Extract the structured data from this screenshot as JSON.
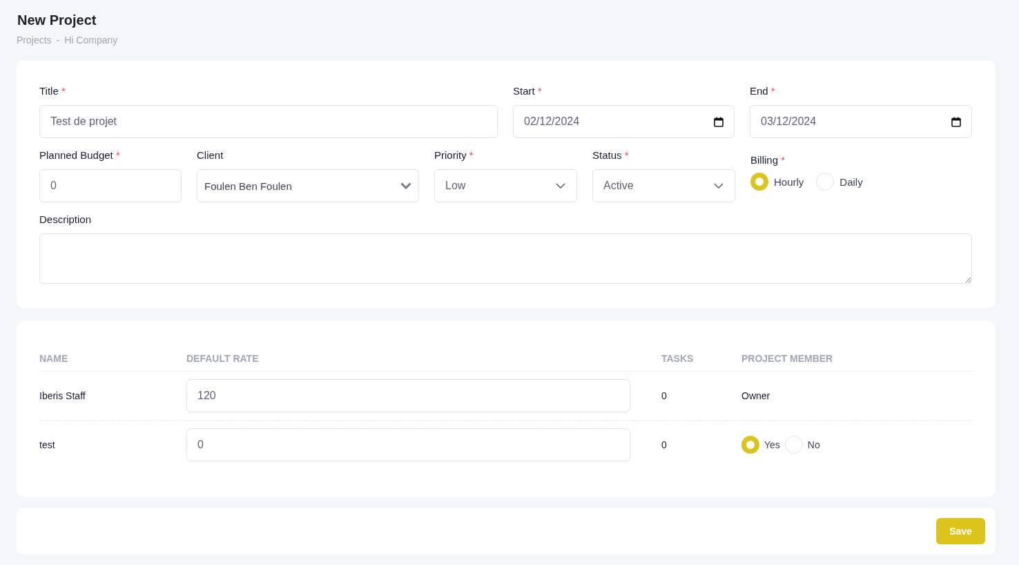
{
  "header": {
    "title": "New Project",
    "breadcrumb": [
      "Projects",
      "Hi Company"
    ],
    "separator": "-"
  },
  "required_mark": "*",
  "form": {
    "rows": [
      {
        "fields": [
          {
            "kind": "text",
            "label": "Title",
            "required": true,
            "value": "Test de projet"
          },
          {
            "kind": "date",
            "label": "Start",
            "required": true,
            "value": "02/12/2024"
          },
          {
            "kind": "date",
            "label": "End",
            "required": true,
            "value": "03/12/2024"
          }
        ]
      },
      {
        "fields": [
          {
            "kind": "number",
            "label": "Planned Budget",
            "required": true,
            "value": "0"
          },
          {
            "kind": "select",
            "label": "Client",
            "required": false,
            "value": "Foulen Ben Foulen"
          },
          {
            "kind": "select",
            "label": "Priority",
            "required": true,
            "value": "Low"
          },
          {
            "kind": "select",
            "label": "Status",
            "required": true,
            "value": "Active"
          },
          {
            "kind": "radio",
            "label": "Billing",
            "required": true,
            "options": [
              {
                "label": "Hourly",
                "selected": true
              },
              {
                "label": "Daily",
                "selected": false
              }
            ]
          }
        ]
      },
      {
        "fields": [
          {
            "kind": "textarea",
            "label": "Description",
            "required": false
          }
        ]
      }
    ]
  },
  "members": {
    "columns": [
      "NAME",
      "DEFAULT RATE",
      "TASKS",
      "PROJECT MEMBER"
    ],
    "rows": [
      {
        "name": "Iberis Staff",
        "rate": "120",
        "tasks": "0",
        "member": {
          "kind": "text",
          "text": "Owner"
        }
      },
      {
        "name": "test",
        "rate": "0",
        "tasks": "0",
        "member": {
          "kind": "radio",
          "options": [
            {
              "label": "Yes",
              "selected": true
            },
            {
              "label": "No",
              "selected": false
            }
          ]
        }
      }
    ]
  },
  "footer": {
    "save": "Save"
  }
}
